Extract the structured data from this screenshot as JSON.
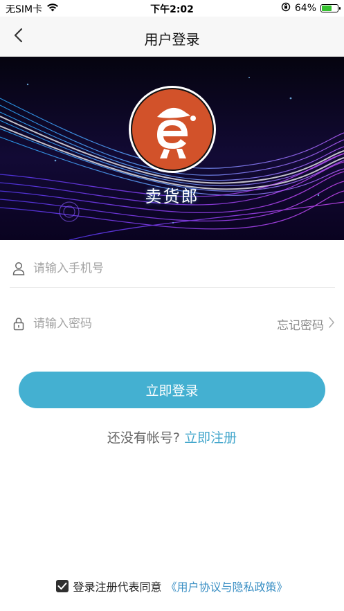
{
  "status_bar": {
    "carrier": "无SIM卡",
    "time": "下午2:02",
    "battery_percent": "64%",
    "battery_level": 0.64,
    "battery_color": "#35c22f"
  },
  "nav": {
    "title": "用户登录",
    "back_icon": "chevron-left-icon"
  },
  "banner": {
    "brand_name": "卖货郎",
    "logo_icon": "cowboy-e-mascot-logo"
  },
  "form": {
    "phone_placeholder": "请输入手机号",
    "phone_value": "",
    "password_placeholder": "请输入密码",
    "password_value": "",
    "forgot_password": "忘记密码"
  },
  "login_button": "立即登录",
  "register": {
    "prompt": "还没有帐号?",
    "link": "立即注册"
  },
  "agreement": {
    "checked": true,
    "text": "登录注册代表同意",
    "link": "《用户协议与隐私政策》"
  },
  "colors": {
    "accent": "#44b0d1",
    "link": "#44a7cc",
    "logo_bg": "#d2522a"
  }
}
